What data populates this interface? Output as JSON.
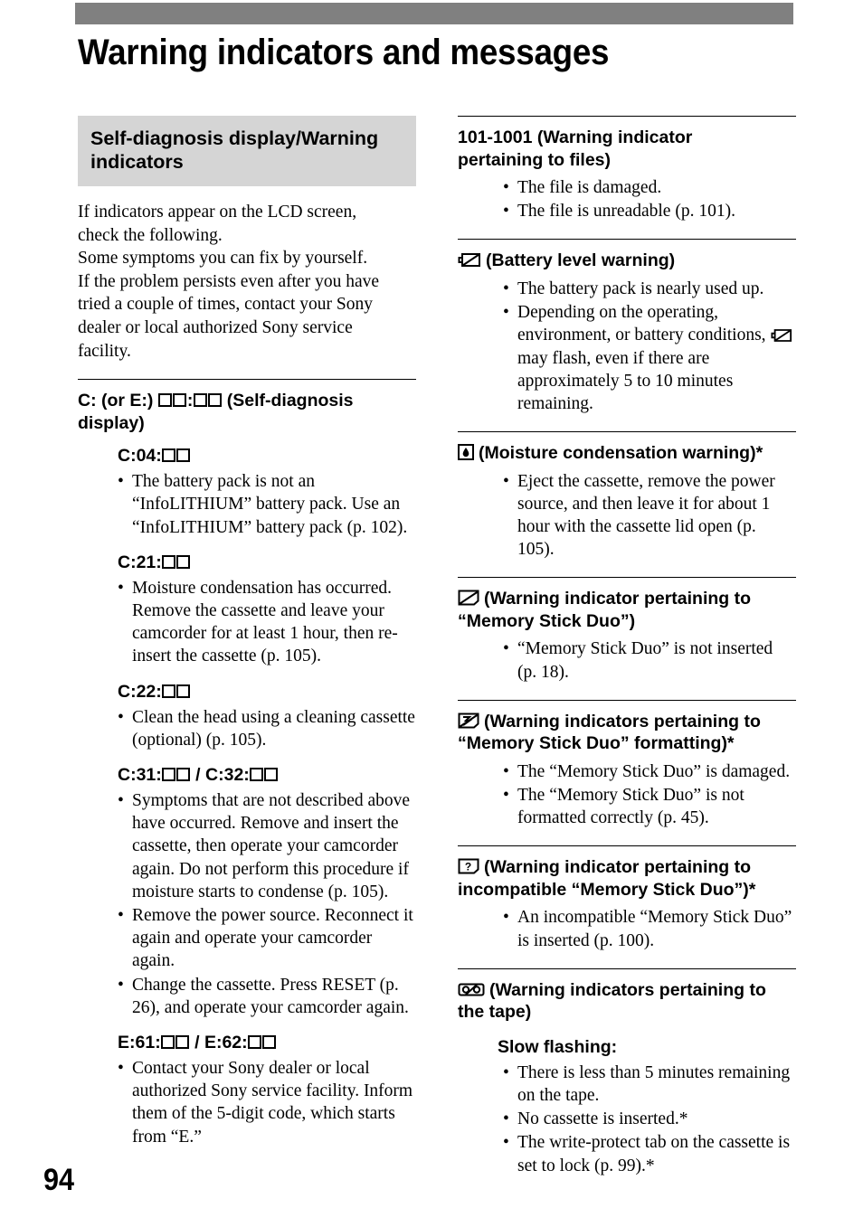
{
  "page": {
    "title": "Warning indicators and messages",
    "number": "94",
    "band_color": "#808080",
    "header_box_color": "#d5d5d5"
  },
  "left_column": {
    "section_header": {
      "line1": "Self-diagnosis display/Warning",
      "line2": "indicators"
    },
    "intro": {
      "line1": "If indicators appear on the LCD screen,",
      "line2": "check the following.",
      "line3": "Some symptoms you can fix by yourself.",
      "line4": "If the problem persists even after you have",
      "line5": "tried a couple of times, contact your Sony",
      "line6": "dealer or local authorized Sony service",
      "line7": "facility."
    },
    "self_diagnosis": {
      "heading_line1_prefix": "C: (or E:) ",
      "heading_line1_suffix": " (Self-diagnosis",
      "heading_line2": "display)",
      "entries": [
        {
          "code_prefix": "C:04:",
          "bullets": [
            "The battery pack is not an “InfoLITHIUM” battery pack. Use an “InfoLITHIUM” battery pack (p. 102)."
          ]
        },
        {
          "code_prefix": "C:21:",
          "bullets": [
            "Moisture condensation has occurred. Remove the cassette and leave your camcorder for at least 1 hour, then re-insert the cassette (p. 105)."
          ]
        },
        {
          "code_prefix": "C:22:",
          "bullets": [
            "Clean the head using a cleaning cassette (optional) (p. 105)."
          ]
        },
        {
          "code_prefix": "C:31:",
          "code_mid": " / C:32:",
          "bullets": [
            "Symptoms that are not described above have occurred. Remove and insert the cassette, then operate your camcorder again. Do not perform this procedure if moisture starts to condense (p. 105).",
            "Remove the power source. Reconnect it again and operate your camcorder again.",
            "Change the cassette. Press RESET (p. 26), and operate your camcorder again."
          ]
        },
        {
          "code_prefix": "E:61:",
          "code_mid": " / E:62:",
          "bullets": [
            "Contact your Sony dealer or local authorized Sony service facility. Inform them of the 5-digit code, which starts from “E.”"
          ]
        }
      ]
    }
  },
  "right_column": {
    "sections": [
      {
        "id": "files",
        "icon": null,
        "heading_line1": "101-1001 (Warning indicator",
        "heading_line2": "pertaining to files)",
        "bullets": [
          "The file is damaged.",
          "The file is unreadable (p. 101)."
        ]
      },
      {
        "id": "battery",
        "icon": "battery-slash-icon",
        "heading_line1": "(Battery level warning)",
        "heading_line2": "",
        "bullets": [
          "The battery pack is nearly used up."
        ],
        "bullet_with_icon": {
          "before": "Depending on the operating, environment, or battery conditions,",
          "after": "may flash, even if there are approximately 5 to 10 minutes remaining."
        }
      },
      {
        "id": "moisture",
        "icon": "moisture-droplet-icon",
        "heading_line1": "(Moisture condensation warning)*",
        "heading_line2": "",
        "bullets": [
          "Eject the cassette, remove the power source, and then leave it for about 1 hour with the cassette lid open (p. 105)."
        ]
      },
      {
        "id": "memory-stick",
        "icon": "memory-stick-slash-icon",
        "heading_line1": "(Warning indicator pertaining to",
        "heading_line2": "“Memory Stick Duo”)",
        "bullets": [
          "“Memory Stick Duo” is not inserted (p. 18)."
        ]
      },
      {
        "id": "memory-stick-format",
        "icon": "memory-stick-format-icon",
        "heading_line1": "(Warning indicators pertaining to",
        "heading_line2": "“Memory Stick Duo” formatting)*",
        "bullets": [
          "The “Memory Stick Duo” is damaged.",
          "The “Memory Stick Duo” is not formatted correctly (p. 45)."
        ]
      },
      {
        "id": "memory-stick-incompatible",
        "icon": "memory-stick-question-icon",
        "heading_line1": "(Warning indicator pertaining to",
        "heading_line2": "incompatible “Memory Stick Duo”)*",
        "bullets": [
          "An incompatible “Memory Stick Duo” is inserted (p. 100)."
        ]
      },
      {
        "id": "tape",
        "icon": "cassette-tape-slash-icon",
        "heading_line1": "(Warning indicators pertaining to",
        "heading_line2": "the tape)",
        "sub_heading": "Slow flashing:",
        "bullets": [
          "There is less than 5 minutes remaining on the tape.",
          "No cassette is inserted.*",
          "The write-protect tab on the cassette is set to lock (p. 99).*"
        ]
      }
    ]
  }
}
